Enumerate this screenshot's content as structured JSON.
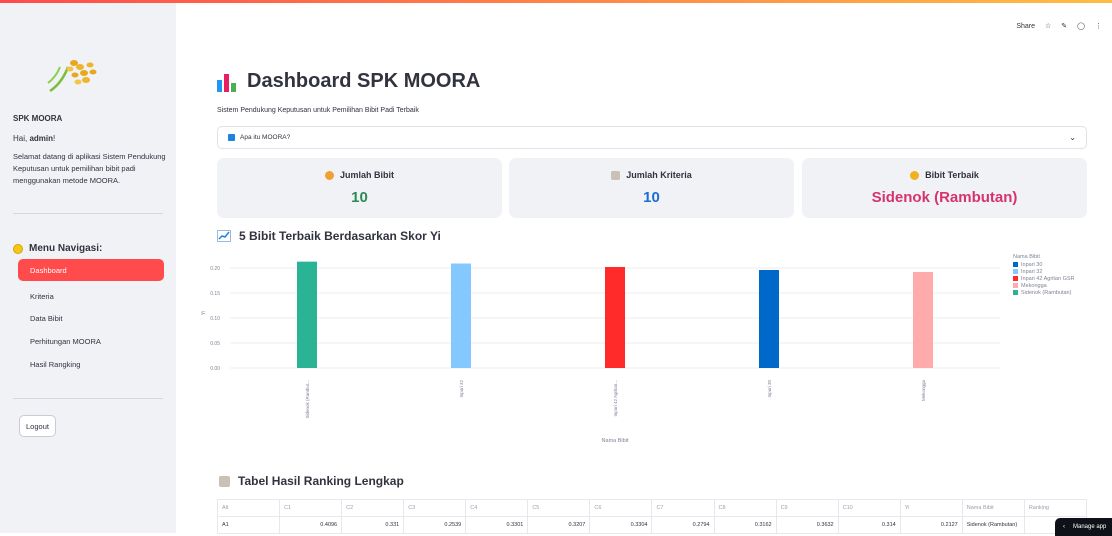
{
  "sidebar": {
    "app_title": "SPK MOORA",
    "greeting_prefix": "Hai, ",
    "greeting_user": "admin",
    "greeting_suffix": "!",
    "welcome": "Selamat datang di aplikasi Sistem Pendukung Keputusan untuk pemilihan bibit padi menggunakan metode MOORA.",
    "menu_title": "Menu Navigasi:",
    "nav": [
      "Dashboard",
      "Kriteria",
      "Data Bibit",
      "Perhitungan MOORA",
      "Hasil Rangking"
    ],
    "active_nav": "Dashboard",
    "logout": "Logout"
  },
  "header": {
    "share": "Share"
  },
  "main": {
    "title": "Dashboard SPK MOORA",
    "subtitle": "Sistem Pendukung Keputusan untuk Pemilihan Bibit Padi Terbaik",
    "expander": "Apa itu MOORA?"
  },
  "metrics": [
    {
      "label": "Jumlah Bibit",
      "value": "10",
      "color": "#2e8b57"
    },
    {
      "label": "Jumlah Kriteria",
      "value": "10",
      "color": "#1c6fd1"
    },
    {
      "label": "Bibit Terbaik",
      "value": "Sidenok (Rambutan)",
      "color": "#d6336c"
    }
  ],
  "chart_title": "5 Bibit Terbaik Berdasarkan Skor Yi",
  "chart_data": {
    "type": "bar",
    "categories": [
      "Sidenok (Rambut...",
      "Inpari 32",
      "Inpari 42 Agritan...",
      "Inpari 30",
      "Mekongga"
    ],
    "values": [
      0.2127,
      0.209,
      0.202,
      0.196,
      0.192
    ],
    "colors": [
      "#2bb395",
      "#83c9ff",
      "#ff2b2b",
      "#0068c9",
      "#ffabab"
    ],
    "xlabel": "Nama Bibit",
    "ylabel": "Yi",
    "yticks": [
      "0.20",
      "0.15",
      "0.10",
      "0.05",
      "0.00"
    ],
    "ylim": [
      0,
      0.22
    ],
    "legend_title": "Nama Bibit",
    "legend": [
      {
        "name": "Inpari 30",
        "color": "#0068c9"
      },
      {
        "name": "Inpari 32",
        "color": "#83c9ff"
      },
      {
        "name": "Inpari 42 Agritan GSR",
        "color": "#ff2b2b"
      },
      {
        "name": "Mekongga",
        "color": "#ffabab"
      },
      {
        "name": "Sidenok (Rambutan)",
        "color": "#2bb395"
      }
    ],
    "legend_position": "right"
  },
  "table": {
    "title": "Tabel Hasil Ranking Lengkap",
    "headers": [
      "Alt",
      "C1",
      "C2",
      "C3",
      "C4",
      "C5",
      "C6",
      "C7",
      "C8",
      "C9",
      "C10",
      "Yi",
      "Nama Bibit",
      "Ranking"
    ],
    "rows": [
      [
        "A1",
        "0.4096",
        "0.331",
        "0.2539",
        "0.3301",
        "0.3207",
        "0.3304",
        "0.2794",
        "0.3162",
        "0.3632",
        "0.314",
        "0.2127",
        "Sidenok (Rambutan)",
        ""
      ]
    ]
  },
  "manage_app": "Manage app"
}
